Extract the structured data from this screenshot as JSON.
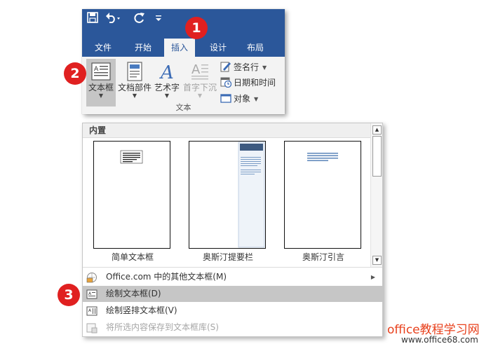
{
  "colors": {
    "ribbon_blue": "#2b579a",
    "badge_red": "#e02020",
    "watermark_red": "#e8401c"
  },
  "quick_access": {
    "icons": [
      "save-icon",
      "undo-icon",
      "redo-icon",
      "customize-icon"
    ]
  },
  "tabs": [
    {
      "label": "文件",
      "active": false
    },
    {
      "label": "开始",
      "active": false
    },
    {
      "label": "插入",
      "active": true
    },
    {
      "label": "设计",
      "active": false
    },
    {
      "label": "布局",
      "active": false
    }
  ],
  "text_group": {
    "label": "文本",
    "buttons": [
      {
        "label": "文本框",
        "icon": "textbox-icon",
        "state": "pressed"
      },
      {
        "label": "文档部件",
        "icon": "quick-parts-icon",
        "state": "normal"
      },
      {
        "label": "艺术字",
        "icon": "wordart-icon",
        "state": "normal"
      },
      {
        "label": "首字下沉",
        "icon": "drop-cap-icon",
        "state": "disabled"
      }
    ],
    "small_buttons": [
      {
        "label": "签名行",
        "icon": "signature-line-icon"
      },
      {
        "label": "日期和时间",
        "icon": "date-time-icon"
      },
      {
        "label": "对象",
        "icon": "object-icon"
      }
    ]
  },
  "gallery": {
    "header": "内置",
    "items": [
      {
        "label": "简单文本框"
      },
      {
        "label": "奥斯汀提要栏"
      },
      {
        "label": "奥斯汀引言"
      }
    ],
    "menu": [
      {
        "label": "Office.com 中的其他文本框(M)",
        "icon": "office-com-icon",
        "state": "normal",
        "has_submenu": true
      },
      {
        "label": "绘制文本框(D)",
        "icon": "draw-textbox-icon",
        "state": "hover",
        "has_submenu": false
      },
      {
        "label": "绘制竖排文本框(V)",
        "icon": "vertical-textbox-icon",
        "state": "normal",
        "has_submenu": false
      },
      {
        "label": "将所选内容保存到文本框库(S)",
        "icon": "save-selection-icon",
        "state": "disabled",
        "has_submenu": false
      }
    ]
  },
  "badges": [
    "1",
    "2",
    "3"
  ],
  "watermark": {
    "title": "office教程学习网",
    "url": "www.office68.com"
  }
}
